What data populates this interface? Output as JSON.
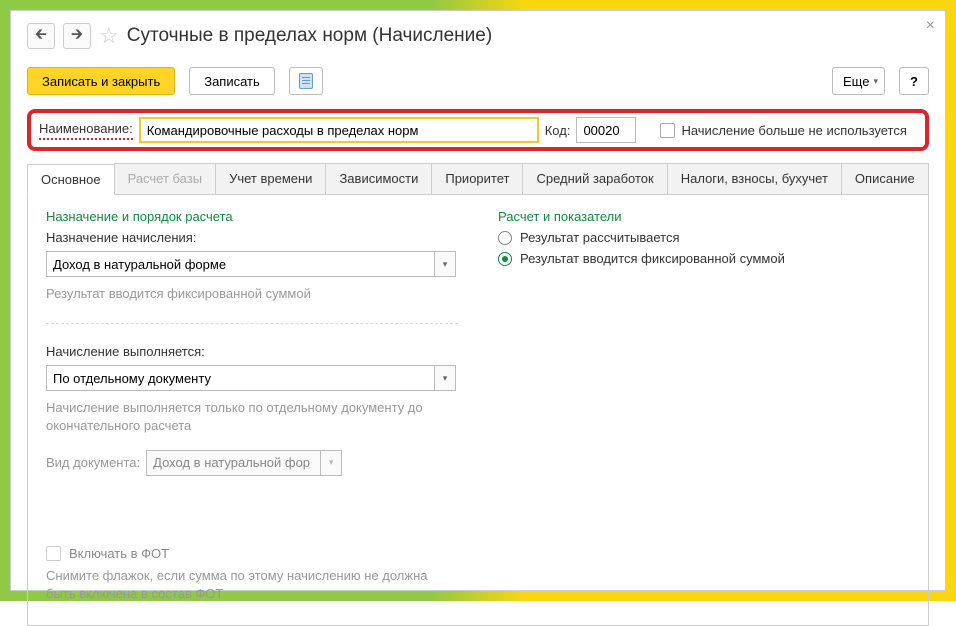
{
  "header": {
    "title": "Суточные в пределах норм (Начисление)",
    "close": "×",
    "nav_back": "🡰",
    "nav_fwd": "🡲",
    "star": "☆"
  },
  "toolbar": {
    "save_close": "Записать и закрыть",
    "save": "Записать",
    "more": "Еще",
    "help": "?"
  },
  "mainRow": {
    "name_label": "Наименование:",
    "name_value": "Командировочные расходы в пределах норм",
    "code_label": "Код:",
    "code_value": "00020",
    "not_used_label": "Начисление больше не используется"
  },
  "tabs": [
    {
      "label": "Основное"
    },
    {
      "label": "Расчет базы"
    },
    {
      "label": "Учет времени"
    },
    {
      "label": "Зависимости"
    },
    {
      "label": "Приоритет"
    },
    {
      "label": "Средний заработок"
    },
    {
      "label": "Налоги, взносы, бухучет"
    },
    {
      "label": "Описание"
    }
  ],
  "left": {
    "section1_title": "Назначение и порядок расчета",
    "assign_label": "Назначение начисления:",
    "assign_value": "Доход в натуральной форме",
    "assign_hint": "Результат вводится фиксированной суммой",
    "exec_label": "Начисление выполняется:",
    "exec_value": "По отдельному документу",
    "exec_hint": "Начисление выполняется только по отдельному документу до окончательного расчета",
    "doc_type_label": "Вид документа:",
    "doc_type_value": "Доход в натуральной фор",
    "fot_label": "Включать в ФОТ",
    "fot_hint": "Снимите флажок, если сумма по этому начислению не должна быть включена в состав ФОТ"
  },
  "right": {
    "section_title": "Расчет и показатели",
    "radio1": "Результат рассчитывается",
    "radio2": "Результат вводится фиксированной суммой"
  },
  "caret": "▾"
}
